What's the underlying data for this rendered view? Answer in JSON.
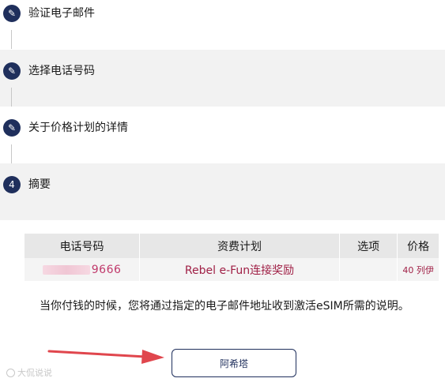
{
  "steps": [
    {
      "label": "验证电子邮件",
      "icon": "pencil-icon",
      "marker": "✎"
    },
    {
      "label": "选择电话号码",
      "icon": "pencil-icon",
      "marker": "✎"
    },
    {
      "label": "关于价格计划的详情",
      "icon": "pencil-icon",
      "marker": "✎"
    },
    {
      "label": "摘要",
      "icon": "number-badge",
      "marker": "4"
    }
  ],
  "summary_table": {
    "headers": [
      "电话号码",
      "资费计划",
      "选项",
      "价格"
    ],
    "row": {
      "phone": "9666",
      "plan": "Rebel e-Fun连接奖励",
      "option": "",
      "price": "40 列伊"
    }
  },
  "note": "当你付钱的时候，您将通过指定的电子邮件地址收到激活eSIM所需的说明。",
  "action_button": "阿希塔",
  "watermark": "大侃说说",
  "colors": {
    "accent": "#1f2f5c",
    "price_text": "#a02046",
    "arrow": "#e0464d"
  }
}
